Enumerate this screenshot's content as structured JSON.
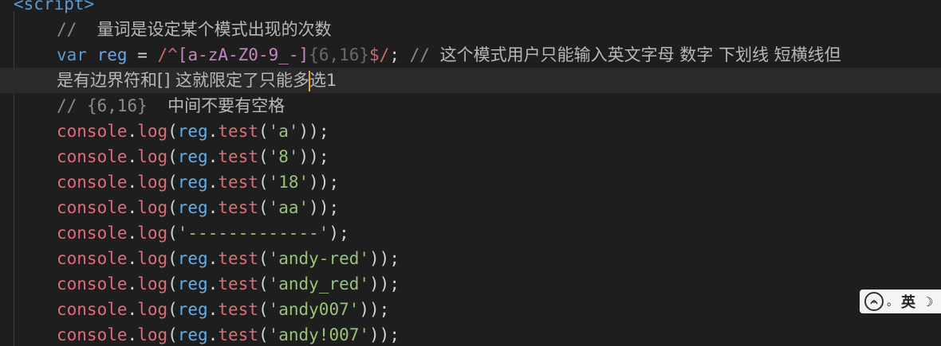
{
  "editor": {
    "tag_line": "<script>",
    "line_comment_1": {
      "slashes": "//",
      "text": "量词是设定某个模式出现的次数"
    },
    "line_var": {
      "keyword": "var",
      "name": "reg",
      "eq": "=",
      "regex_open": "/^",
      "char_class": "[a-zA-Z0-9_-]",
      "quantifier": "{6,16}",
      "regex_close": "$/",
      "semicolon": ";",
      "comment_slashes": "//",
      "comment_text": "这个模式用户只能输入英文字母 数字 下划线 短横线但"
    },
    "line_wrap": {
      "text_before_cursor": "是有边界符和[] 这就限定了只能多",
      "text_after_cursor": "选1"
    },
    "line_comment_2": {
      "slashes": "//",
      "code": "{6,16}",
      "text": "中间不要有空格"
    },
    "console_lines": [
      {
        "obj": "console",
        "fn": "log",
        "target": "reg",
        "method": "test",
        "arg": "'a'"
      },
      {
        "obj": "console",
        "fn": "log",
        "target": "reg",
        "method": "test",
        "arg": "'8'"
      },
      {
        "obj": "console",
        "fn": "log",
        "target": "reg",
        "method": "test",
        "arg": "'18'"
      },
      {
        "obj": "console",
        "fn": "log",
        "target": "reg",
        "method": "test",
        "arg": "'aa'"
      },
      {
        "obj": "console",
        "fn": "log",
        "plain_arg": "'-------------'"
      },
      {
        "obj": "console",
        "fn": "log",
        "target": "reg",
        "method": "test",
        "arg": "'andy-red'"
      },
      {
        "obj": "console",
        "fn": "log",
        "target": "reg",
        "method": "test",
        "arg": "'andy_red'"
      },
      {
        "obj": "console",
        "fn": "log",
        "target": "reg",
        "method": "test",
        "arg": "'andy007'"
      },
      {
        "obj": "console",
        "fn": "log",
        "target": "reg",
        "method": "test",
        "arg": "'andy!007'"
      }
    ]
  },
  "ime": {
    "logo": "iFly",
    "separator": "。",
    "lang": "英",
    "icon": "moon-icon"
  },
  "colors": {
    "background": "#1e1e1e",
    "current_line": "#2a2a2a",
    "cursor": "#e8a33a",
    "string": "#98c379",
    "console": "#e06c75",
    "variable": "#61afef",
    "keyword": "#569cd6",
    "regex": "#d16969",
    "comment": "#8a8a8a"
  }
}
